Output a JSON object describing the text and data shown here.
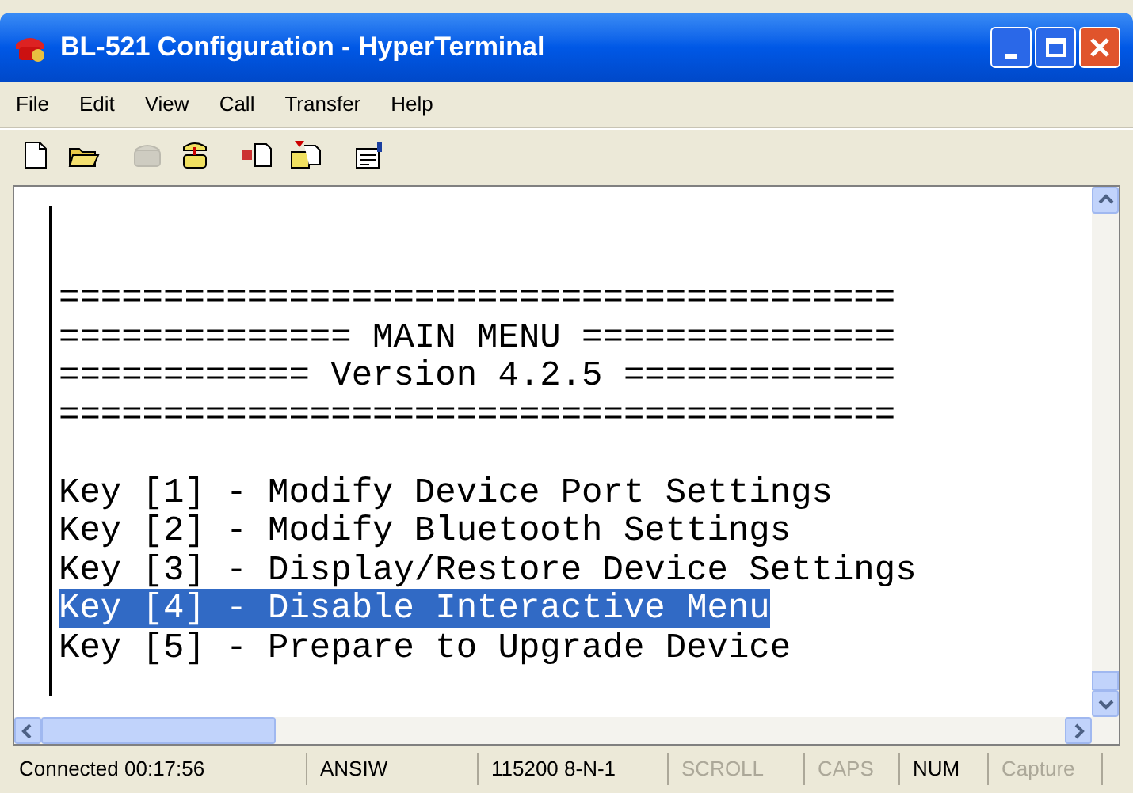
{
  "window": {
    "title": "BL-521 Configuration - HyperTerminal"
  },
  "menu": [
    "File",
    "Edit",
    "View",
    "Call",
    "Transfer",
    "Help"
  ],
  "toolbar": [
    {
      "kind": "new",
      "disabled": false
    },
    {
      "kind": "open",
      "disabled": false
    },
    {
      "kind": "phone",
      "disabled": true
    },
    {
      "kind": "dial",
      "disabled": false
    },
    {
      "kind": "send",
      "disabled": false
    },
    {
      "kind": "receive",
      "disabled": false
    },
    {
      "kind": "properties",
      "disabled": false
    }
  ],
  "terminal": {
    "banner": [
      "========================================",
      "============== MAIN MENU ===============",
      "============ Version 4.2.5 =============",
      "========================================"
    ],
    "menu_items": [
      {
        "text": "Key [1] - Modify Device Port Settings",
        "selected": false
      },
      {
        "text": "Key [2] - Modify Bluetooth Settings",
        "selected": false
      },
      {
        "text": "Key [3] - Display/Restore Device Settings",
        "selected": false
      },
      {
        "text": "Key [4] - Disable Interactive Menu",
        "selected": true
      },
      {
        "text": "Key [5] - Prepare to Upgrade Device",
        "selected": false
      }
    ]
  },
  "status_bar": [
    {
      "text": "Connected 00:17:56",
      "disabled": false
    },
    {
      "text": "ANSIW",
      "disabled": false
    },
    {
      "text": "115200 8-N-1",
      "disabled": false
    },
    {
      "text": "SCROLL",
      "disabled": true
    },
    {
      "text": "CAPS",
      "disabled": true
    },
    {
      "text": "NUM",
      "disabled": false
    },
    {
      "text": "Capture",
      "disabled": true
    }
  ]
}
